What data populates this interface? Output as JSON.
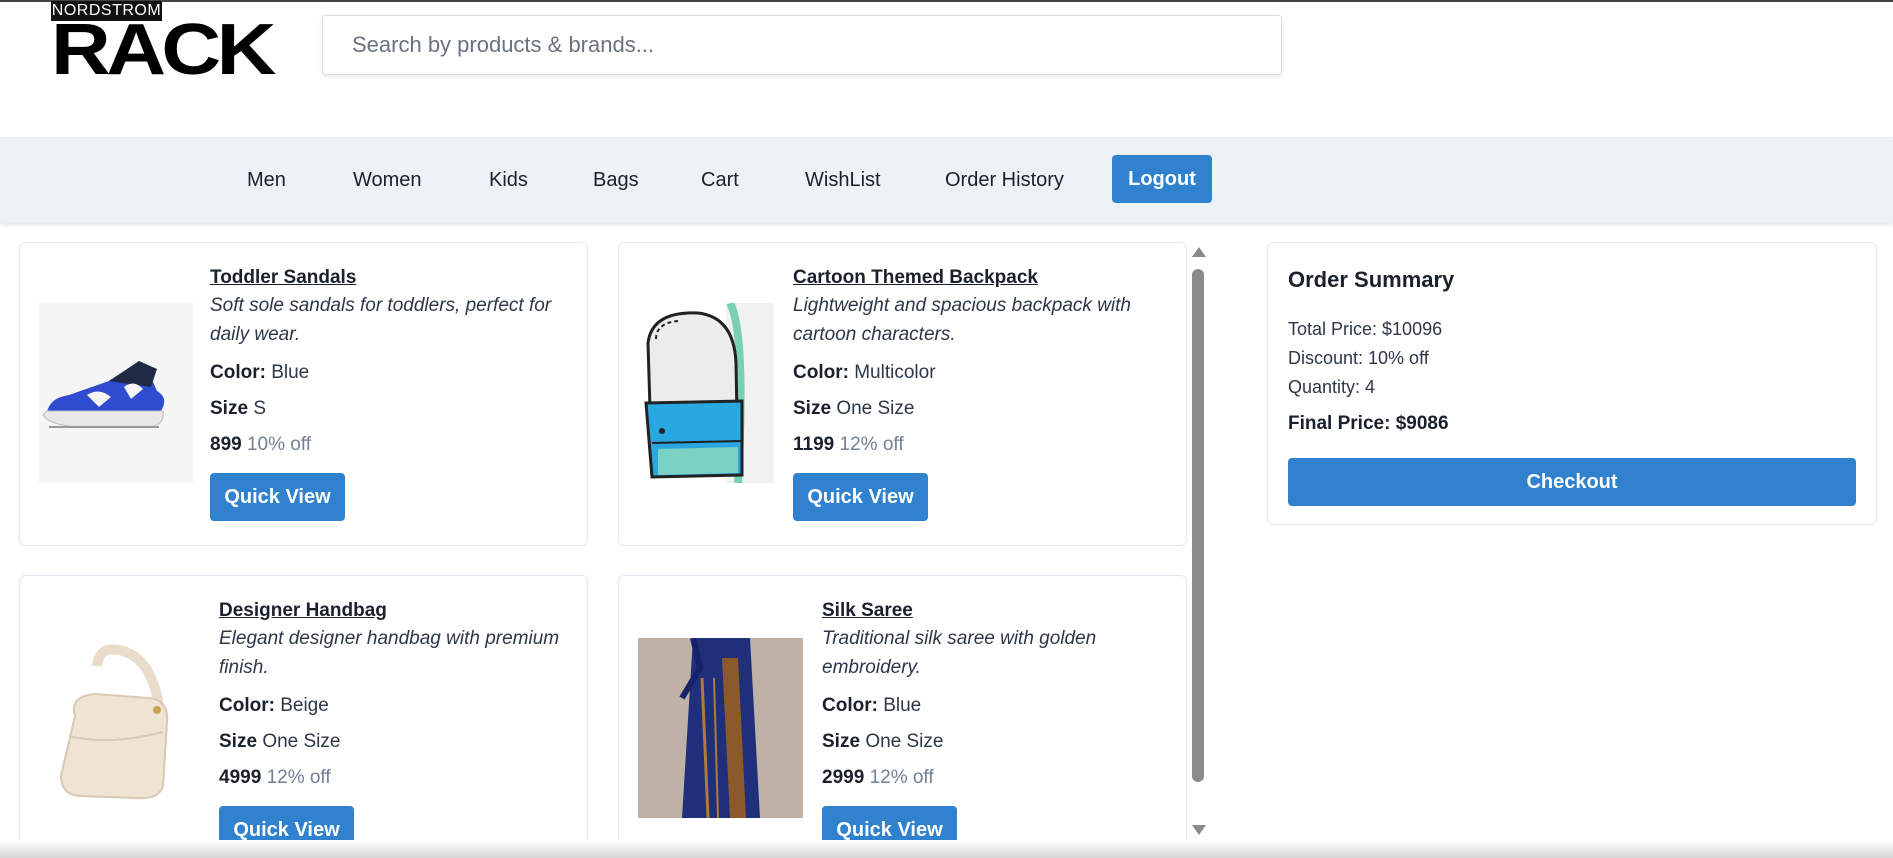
{
  "brand": {
    "top": "NORDSTROM",
    "main": "RACK"
  },
  "search": {
    "placeholder": "Search by products & brands..."
  },
  "nav": {
    "items": [
      "Men",
      "Women",
      "Kids",
      "Bags",
      "Cart",
      "WishList",
      "Order History"
    ],
    "logout": "Logout"
  },
  "labels": {
    "color": "Color:",
    "size": "Size",
    "quick_view": "Quick View"
  },
  "products": [
    {
      "title": "Toddler Sandals",
      "description": "Soft sole sandals for toddlers, perfect for daily wear.",
      "color": "Blue",
      "size": "S",
      "price": "899",
      "discount": "10% off",
      "image": "sandal-image"
    },
    {
      "title": "Cartoon Themed Backpack",
      "description": "Lightweight and spacious backpack with cartoon characters.",
      "color": "Multicolor",
      "size": "One Size",
      "price": "1199",
      "discount": "12% off",
      "image": "backpack-image"
    },
    {
      "title": "Designer Handbag",
      "description": "Elegant designer handbag with premium finish.",
      "color": "Beige",
      "size": "One Size",
      "price": "4999",
      "discount": "12% off",
      "image": "handbag-image"
    },
    {
      "title": "Silk Saree",
      "description": "Traditional silk saree with golden embroidery.",
      "color": "Blue",
      "size": "One Size",
      "price": "2999",
      "discount": "12% off",
      "image": "saree-image"
    }
  ],
  "summary": {
    "title": "Order Summary",
    "total": "Total Price: $10096",
    "discount": "Discount: 10% off",
    "quantity": "Quantity: 4",
    "final": "Final Price: $9086",
    "checkout": "Checkout"
  },
  "colors": {
    "accent": "#3182ce",
    "nav_bg": "#edf2f7"
  }
}
